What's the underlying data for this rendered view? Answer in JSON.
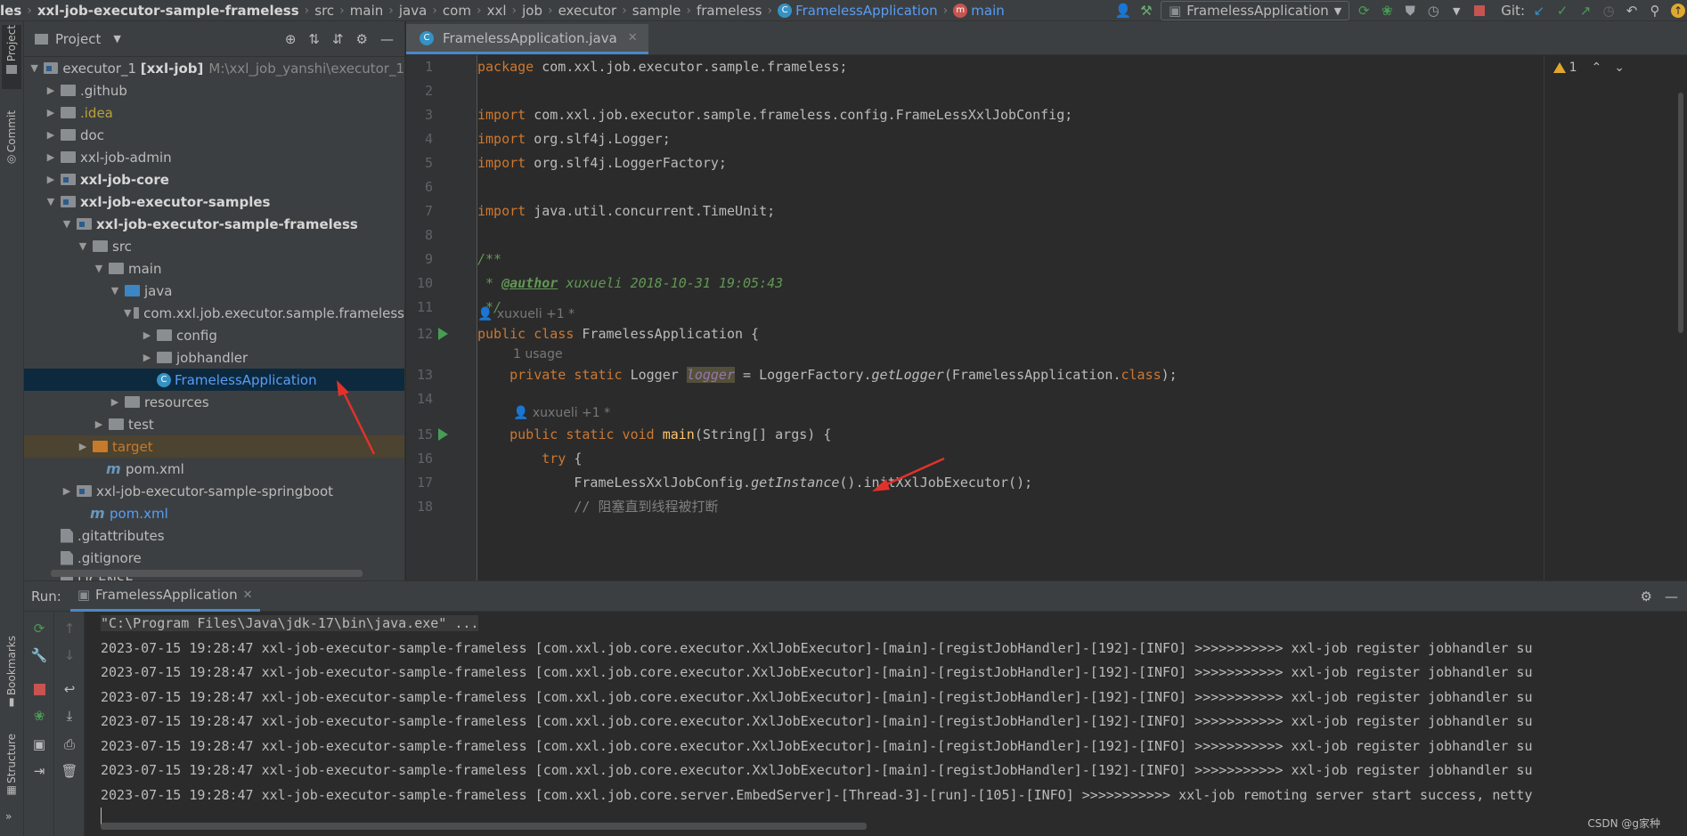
{
  "navbar": {
    "crumbs": [
      "les",
      "xxl-job-executor-sample-frameless",
      "src",
      "main",
      "java",
      "com",
      "xxl",
      "job",
      "executor",
      "sample",
      "frameless",
      "FramelessApplication",
      "main"
    ],
    "run_config": "FramelessApplication",
    "git_label": "Git:"
  },
  "left_stripe": {
    "project_tab": "Project",
    "commit_tab": "Commit",
    "bookmarks_tab": "Bookmarks",
    "structure_tab": "Structure"
  },
  "project_panel": {
    "title": "Project",
    "root_label": "executor_1",
    "root_bold": "[xxl-job]",
    "root_path": "M:\\xxl_job_yanshi\\executor_1",
    "items": [
      {
        "label": ".github"
      },
      {
        "label": ".idea"
      },
      {
        "label": "doc"
      },
      {
        "label": "xxl-job-admin"
      },
      {
        "label": "xxl-job-core"
      },
      {
        "label": "xxl-job-executor-samples"
      },
      {
        "label": "xxl-job-executor-sample-frameless"
      },
      {
        "label": "src"
      },
      {
        "label": "main"
      },
      {
        "label": "java"
      },
      {
        "label": "com.xxl.job.executor.sample.frameless"
      },
      {
        "label": "config"
      },
      {
        "label": "jobhandler"
      },
      {
        "label": "FramelessApplication"
      },
      {
        "label": "resources"
      },
      {
        "label": "test"
      },
      {
        "label": "target"
      },
      {
        "label": "pom.xml"
      },
      {
        "label": "xxl-job-executor-sample-springboot"
      },
      {
        "label": "pom.xml"
      },
      {
        "label": ".gitattributes"
      },
      {
        "label": ".gitignore"
      },
      {
        "label": "LICENSE"
      }
    ]
  },
  "editor": {
    "tab_label": "FramelessApplication.java",
    "warning_count": "1",
    "lines": [
      {
        "n": "1"
      },
      {
        "n": "2"
      },
      {
        "n": "3"
      },
      {
        "n": "4"
      },
      {
        "n": "5"
      },
      {
        "n": "6"
      },
      {
        "n": "7"
      },
      {
        "n": "8"
      },
      {
        "n": "9"
      },
      {
        "n": "10"
      },
      {
        "n": "11"
      },
      {
        "n": "12"
      },
      {
        "n": "13"
      },
      {
        "n": "14"
      },
      {
        "n": "15"
      },
      {
        "n": "16"
      },
      {
        "n": "17"
      },
      {
        "n": "18"
      }
    ],
    "code": {
      "l1_kw": "package",
      "l1_rest": " com.xxl.job.executor.sample.frameless;",
      "l3_kw": "import",
      "l3_rest": " com.xxl.job.executor.sample.frameless.config.FrameLessXxlJobConfig;",
      "l4_kw": "import",
      "l4_rest": " org.slf4j.Logger;",
      "l5_kw": "import",
      "l5_rest": " org.slf4j.LoggerFactory;",
      "l7_kw": "import",
      "l7_rest": " java.util.concurrent.TimeUnit;",
      "l9": "/**",
      "l10_pre": " * ",
      "l10_tag": "@author",
      "l10_rest": " xuxueli 2018-10-31 19:05:43",
      "l11": " */",
      "hint_author1": "xuxueli +1 *",
      "l12_kw": "public class",
      "l12_rest": " FramelessApplication {",
      "hint_usage": "1 usage",
      "l13_kw": "private static",
      "l13_type": " Logger ",
      "l13_field": "logger",
      "l13_eq": " = LoggerFactory.",
      "l13_fn": "getLogger",
      "l13_args": "(FramelessApplication.",
      "l13_cls": "class",
      "l13_end": ");",
      "hint_author2": "xuxueli +1 *",
      "l15_kw": "public static void",
      "l15_fn": " main",
      "l15_rest": "(String[] args) {",
      "l16_kw": "try",
      "l16_rest": " {",
      "l17_pre": "FrameLessXxlJobConfig.",
      "l17_fn": "getInstance",
      "l17_rest": "().initXxlJobExecutor();",
      "l18": "// 阻塞直到线程被打断"
    }
  },
  "run_panel": {
    "run_label": "Run:",
    "tab_label": "FramelessApplication",
    "console": [
      "\"C:\\Program Files\\Java\\jdk-17\\bin\\java.exe\" ...",
      "2023-07-15 19:28:47 xxl-job-executor-sample-frameless [com.xxl.job.core.executor.XxlJobExecutor]-[main]-[registJobHandler]-[192]-[INFO] >>>>>>>>>>> xxl-job register jobhandler su",
      "2023-07-15 19:28:47 xxl-job-executor-sample-frameless [com.xxl.job.core.executor.XxlJobExecutor]-[main]-[registJobHandler]-[192]-[INFO] >>>>>>>>>>> xxl-job register jobhandler su",
      "2023-07-15 19:28:47 xxl-job-executor-sample-frameless [com.xxl.job.core.executor.XxlJobExecutor]-[main]-[registJobHandler]-[192]-[INFO] >>>>>>>>>>> xxl-job register jobhandler su",
      "2023-07-15 19:28:47 xxl-job-executor-sample-frameless [com.xxl.job.core.executor.XxlJobExecutor]-[main]-[registJobHandler]-[192]-[INFO] >>>>>>>>>>> xxl-job register jobhandler su",
      "2023-07-15 19:28:47 xxl-job-executor-sample-frameless [com.xxl.job.core.executor.XxlJobExecutor]-[main]-[registJobHandler]-[192]-[INFO] >>>>>>>>>>> xxl-job register jobhandler su",
      "2023-07-15 19:28:47 xxl-job-executor-sample-frameless [com.xxl.job.core.executor.XxlJobExecutor]-[main]-[registJobHandler]-[192]-[INFO] >>>>>>>>>>> xxl-job register jobhandler su",
      "2023-07-15 19:28:47 xxl-job-executor-sample-frameless [com.xxl.job.core.server.EmbedServer]-[Thread-3]-[run]-[105]-[INFO] >>>>>>>>>>> xxl-job remoting server start success, netty"
    ]
  },
  "watermark": "CSDN @g家种",
  "colors": {
    "accent": "#4a88c7",
    "keyword": "#cc7832",
    "comment": "#629755",
    "function": "#ffc66d",
    "field": "#9876aa",
    "run_green": "#499c54",
    "annotation_red": "#e0322b"
  }
}
